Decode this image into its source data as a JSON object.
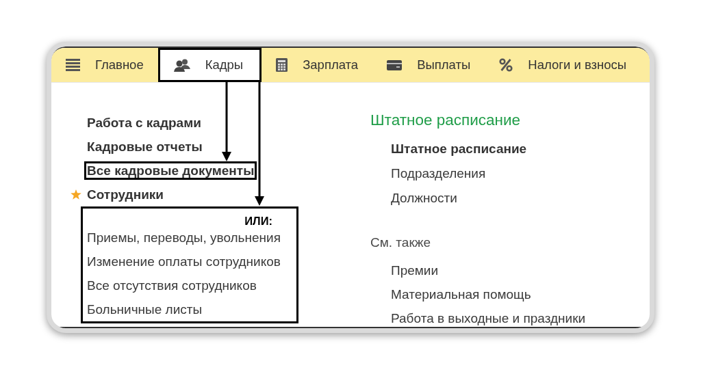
{
  "tabs": [
    {
      "label": "Главное",
      "selected": false
    },
    {
      "label": "Кадры",
      "selected": true
    },
    {
      "label": "Зарплата",
      "selected": false
    },
    {
      "label": "Выплаты",
      "selected": false
    },
    {
      "label": "Налоги и взносы",
      "selected": false
    }
  ],
  "left_menu": [
    {
      "label": "Работа с кадрами",
      "starred": false,
      "highlighted": false
    },
    {
      "label": "Кадровые отчеты",
      "starred": false,
      "highlighted": false
    },
    {
      "label": "Все кадровые документы",
      "starred": false,
      "highlighted": true
    },
    {
      "label": "Сотрудники",
      "starred": true,
      "highlighted": false
    }
  ],
  "alternatives": {
    "label": "ИЛИ:",
    "items": [
      "Приемы, переводы, увольнения",
      "Изменение оплаты сотрудников",
      "Все отсутствия сотрудников",
      "Больничные листы"
    ]
  },
  "staff_schedule": {
    "title": "Штатное расписание",
    "items": [
      {
        "label": "Штатное расписание",
        "bold": true
      },
      {
        "label": "Подразделения",
        "bold": false
      },
      {
        "label": "Должности",
        "bold": false
      }
    ]
  },
  "see_also": {
    "title": "См. также",
    "items": [
      {
        "label": "Премии",
        "bold": false
      },
      {
        "label": "Материальная помощь",
        "bold": false
      },
      {
        "label": "Работа в выходные и праздники",
        "bold": false
      }
    ]
  }
}
